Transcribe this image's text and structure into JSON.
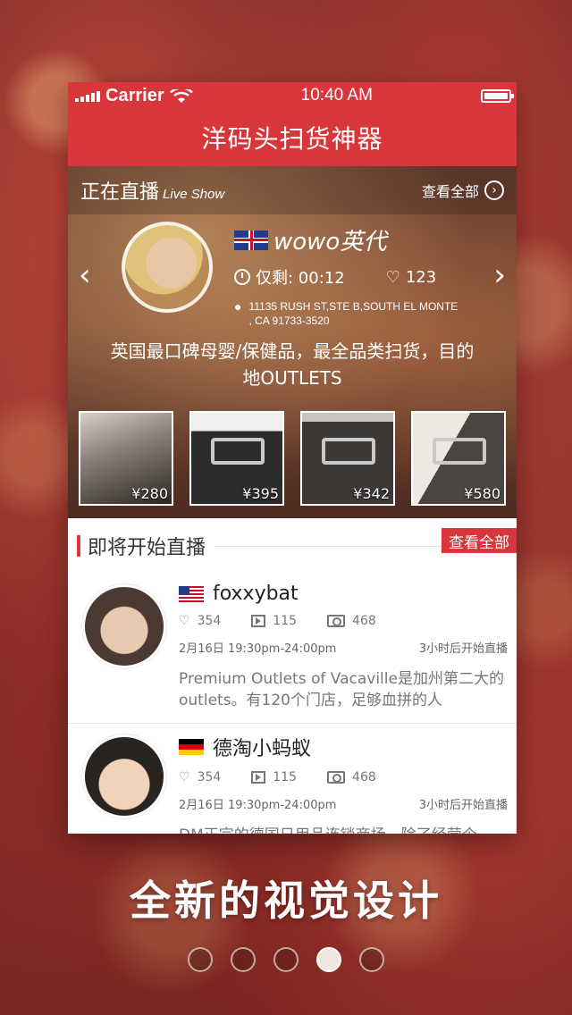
{
  "status_bar": {
    "carrier": "Carrier",
    "time": "10:40 AM"
  },
  "nav": {
    "title": "洋码头扫货神器"
  },
  "live": {
    "title": "正在直播",
    "subtitle": "Live Show",
    "see_all": "查看全部",
    "host": {
      "name": "wowo英代",
      "country_flag": "uk-flag",
      "time_left": "仅剩: 00:12",
      "likes": "123",
      "address_line1": "11135 RUSH ST,STE B,SOUTH EL MONTE",
      "address_line2": ", CA 91733-3520",
      "description": "英国最口碑母婴/保健品，最全品类扫货，目的地OUTLETS"
    },
    "products": [
      {
        "price": "¥280"
      },
      {
        "price": "¥395"
      },
      {
        "price": "¥342"
      },
      {
        "price": "¥580"
      }
    ]
  },
  "upcoming": {
    "title": "即将开始直播",
    "see_all": "查看全部",
    "items": [
      {
        "name": "foxxybat",
        "flag": "us-flag",
        "likes": "354",
        "videos": "115",
        "photos": "468",
        "time": "2月16日 19:30pm-24:00pm",
        "starts_in": "3小时后开始直播",
        "description": "Premium Outlets of Vacaville是加州第二大的outlets。有120个门店，足够血拼的人"
      },
      {
        "name": "德淘小蚂蚁",
        "flag": "de-flag",
        "likes": "354",
        "videos": "115",
        "photos": "468",
        "time": "2月16日 19:30pm-24:00pm",
        "starts_in": "3小时后开始直播",
        "description": "DM正宗的德国日用品连锁商场，除了经营个"
      }
    ]
  },
  "caption": "全新的视觉设计",
  "pagination": {
    "total": 5,
    "active": 4
  },
  "colors": {
    "accent": "#d8363a"
  }
}
